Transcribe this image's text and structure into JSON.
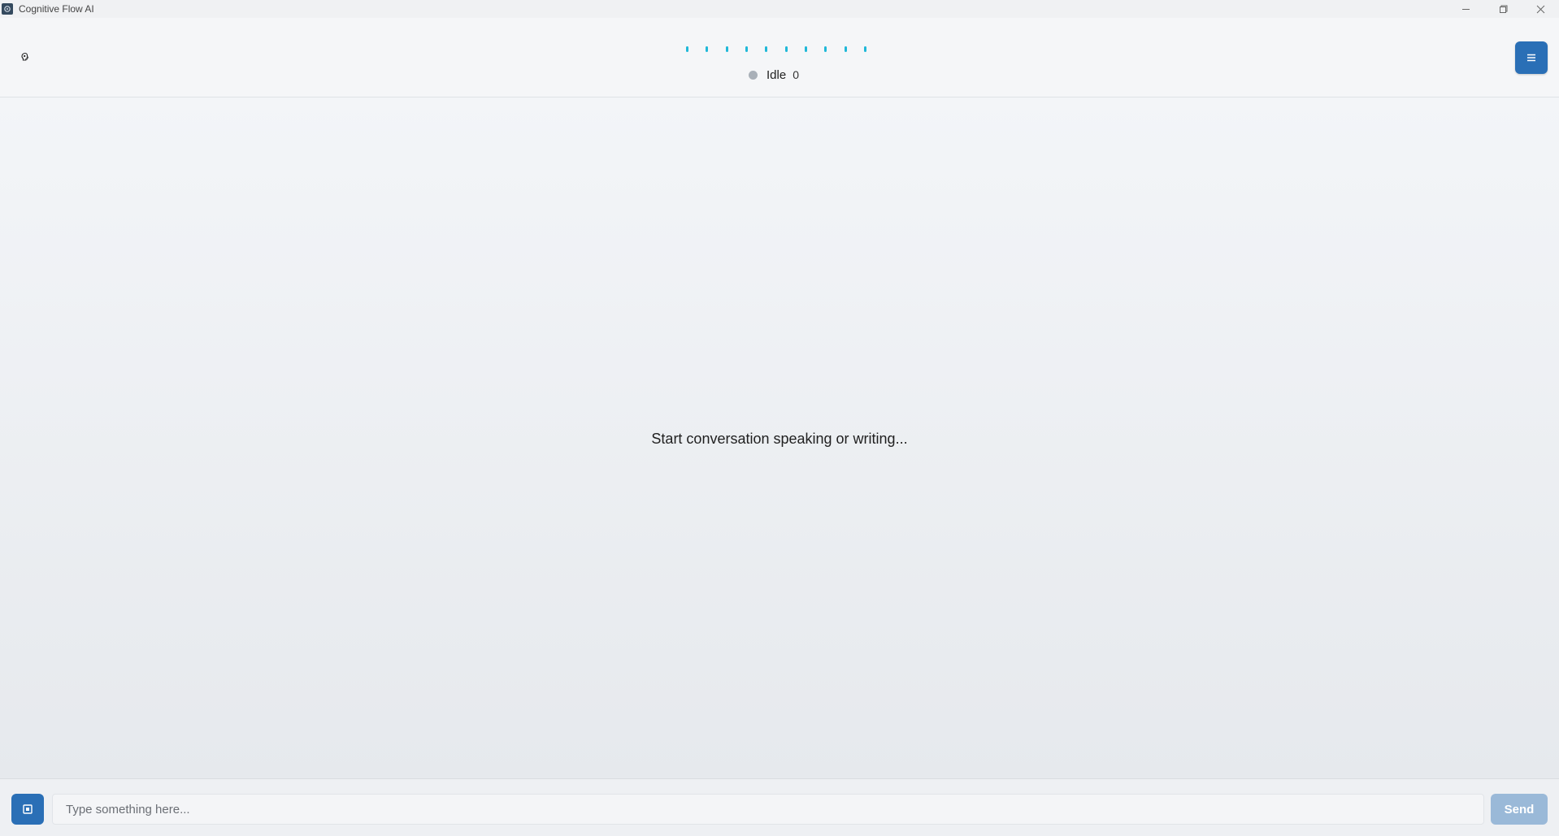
{
  "window": {
    "title": "Cognitive Flow AI",
    "icons": {
      "app": "app-logo-icon",
      "minimize": "minimize-icon",
      "maximize": "maximize-icon",
      "close": "close-icon"
    }
  },
  "header": {
    "left_icon": "brain-icon",
    "waveform_bars": 10,
    "status": {
      "label": "Idle",
      "count": "0",
      "dot_color": "#a9b0b8"
    },
    "menu_icon": "hamburger-menu-icon"
  },
  "main": {
    "empty_message": "Start conversation speaking or writing..."
  },
  "input_bar": {
    "screen_button_icon": "screen-capture-icon",
    "placeholder": "Type something here...",
    "value": "",
    "send_label": "Send"
  },
  "colors": {
    "accent": "#2a6fb6",
    "waveform": "#1fb8d8",
    "send_disabled": "#9ab9d8"
  }
}
